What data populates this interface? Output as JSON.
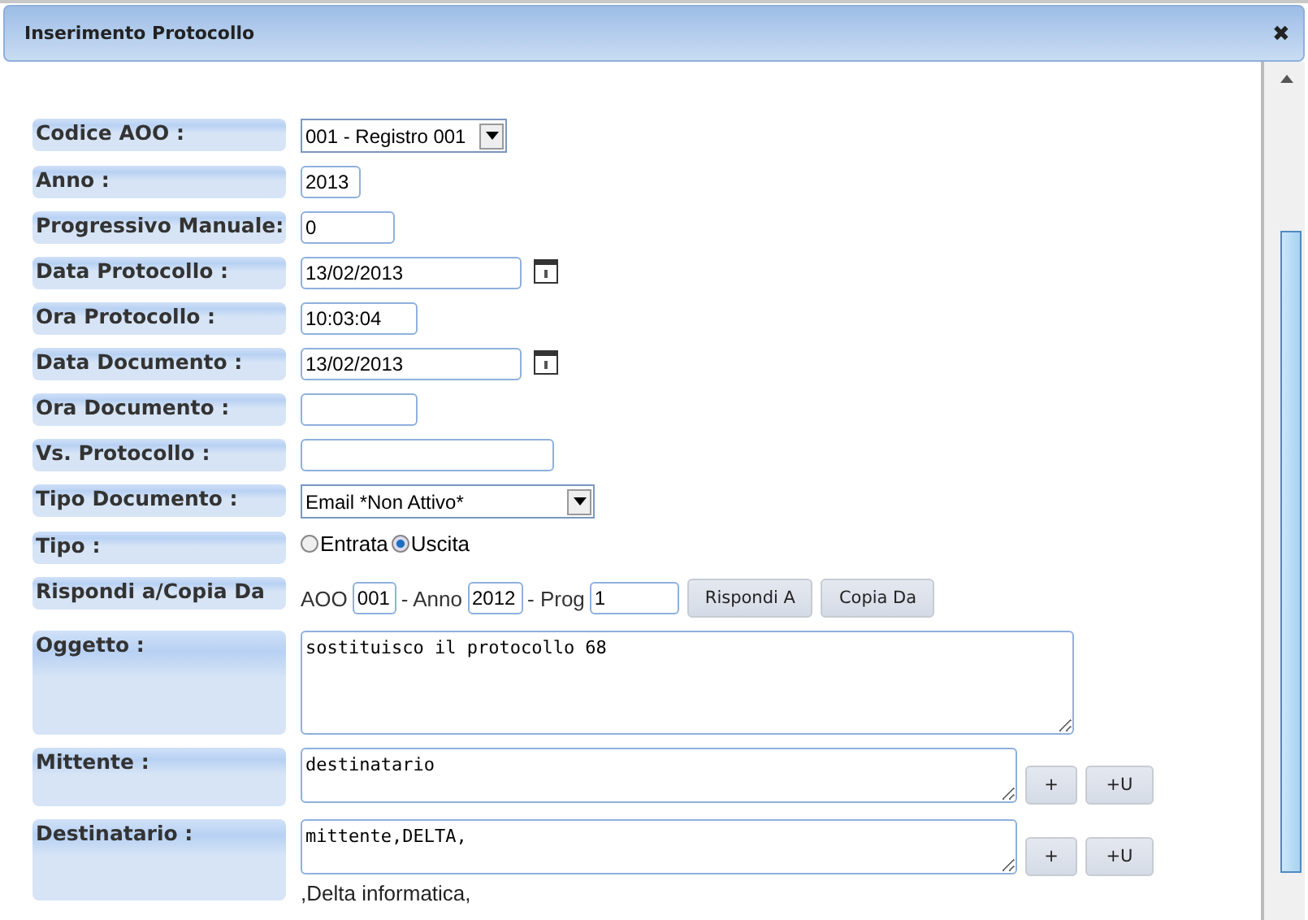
{
  "window": {
    "title": "Inserimento Protocollo",
    "close": "✖"
  },
  "rows": [
    {
      "kind": "select",
      "label": "Codice AOO :",
      "value": "001 - Registro 001"
    },
    {
      "kind": "text",
      "label": "Anno :",
      "value": "2013"
    },
    {
      "kind": "text",
      "label": "Progressivo Manuale:",
      "value": "0"
    },
    {
      "kind": "date",
      "label": "Data Protocollo :",
      "value": "13/02/2013"
    },
    {
      "kind": "text",
      "label": "Ora Protocollo :",
      "value": "10:03:04"
    },
    {
      "kind": "date",
      "label": "Data Documento :",
      "value": "13/02/2013"
    },
    {
      "kind": "text",
      "label": "Ora Documento :"
    },
    {
      "kind": "text",
      "label": "Vs. Protocollo :"
    },
    {
      "kind": "select",
      "label": "Tipo Documento :",
      "value": "Email *Non Attivo*"
    },
    {
      "kind": "radio",
      "label": "Tipo :",
      "options": [
        {
          "label": "Entrata",
          "selected": false
        },
        {
          "label": "Uscita",
          "selected": true
        }
      ]
    },
    {
      "kind": "reply",
      "label": "Rispondi a/Copia Da",
      "aoo_label": "AOO",
      "aoo": "001",
      "anno_label": "- Anno",
      "anno": "2012",
      "prog_label": "- Prog",
      "prog": "1",
      "buttons": [
        "Rispondi A",
        "Copia Da"
      ]
    },
    {
      "kind": "textarea",
      "label": "Oggetto :",
      "value": "sostituisco il protocollo 68"
    },
    {
      "kind": "party",
      "label": "Mittente :",
      "value": "destinatario",
      "buttons": [
        "+",
        "+U"
      ]
    },
    {
      "kind": "party",
      "label": "Destinatario :",
      "value": "mittente,DELTA,",
      "note": ",Delta informatica,",
      "buttons": [
        "+",
        "+U"
      ]
    }
  ]
}
